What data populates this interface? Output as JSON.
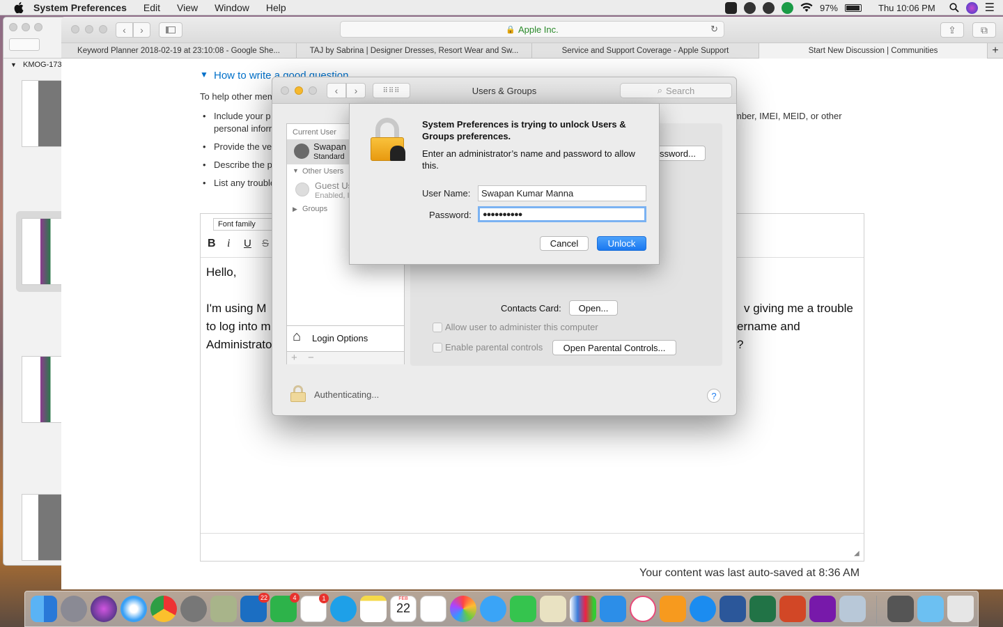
{
  "menubar": {
    "app_name": "System Preferences",
    "items": [
      "Edit",
      "View",
      "Window",
      "Help"
    ],
    "battery": "97%",
    "clock": "Thu 10:06 PM"
  },
  "preview": {
    "doc_label": "KMOG-173"
  },
  "safari": {
    "url": "Apple Inc.",
    "tabs": [
      "Keyword Planner 2018-02-19 at 23:10:08 - Google She...",
      "TAJ by Sabrina | Designer Dresses, Resort Wear and Sw...",
      "Service and Support Coverage - Apple Support",
      "Start New Discussion | Communities"
    ],
    "page": {
      "section_link": "How to write a good question",
      "intro": "To help other mem",
      "bullets": [
        "Include your p",
        "personal inforr",
        "Provide the ve",
        "Describe the p",
        "List any trouble"
      ],
      "right_bullet_text": "mber, IMEI, MEID, or other",
      "font_family": "Font family",
      "editor_lines": [
        "Hello,",
        "I'm using M",
        "to log into m",
        "Administrato"
      ],
      "editor_right_lines": [
        "v giving me a trouble",
        "ername and",
        "?"
      ],
      "autosave": "Your content was last auto-saved at 8:36 AM"
    }
  },
  "prefs": {
    "title": "Users & Groups",
    "search_placeholder": "Search",
    "current_user_header": "Current User",
    "current_user_name": "Swapan I",
    "current_user_role": "Standard",
    "other_users_header": "Other Users",
    "guest_name": "Guest Us",
    "guest_status": "Enabled, I",
    "groups_label": "Groups",
    "login_options": "Login Options",
    "password_button": "ssword...",
    "contacts_card_label": "Contacts Card:",
    "open_button": "Open...",
    "allow_admin": "Allow user to administer this computer",
    "parental_controls": "Enable parental controls",
    "open_parental_button": "Open Parental Controls...",
    "authenticating": "Authenticating...",
    "help": "?"
  },
  "dialog": {
    "heading": "System Preferences is trying to unlock Users & Groups preferences.",
    "message": "Enter an administrator’s name and password to allow this.",
    "username_label": "User Name:",
    "username_value": "Swapan Kumar Manna",
    "password_label": "Password:",
    "password_value": "●●●●●●●●●●",
    "cancel": "Cancel",
    "unlock": "Unlock"
  },
  "dock": {
    "badges": {
      "outlook": "22",
      "messages_green": "4",
      "skype_biz": "1"
    },
    "calendar_month": "FEB",
    "calendar_day": "22"
  }
}
